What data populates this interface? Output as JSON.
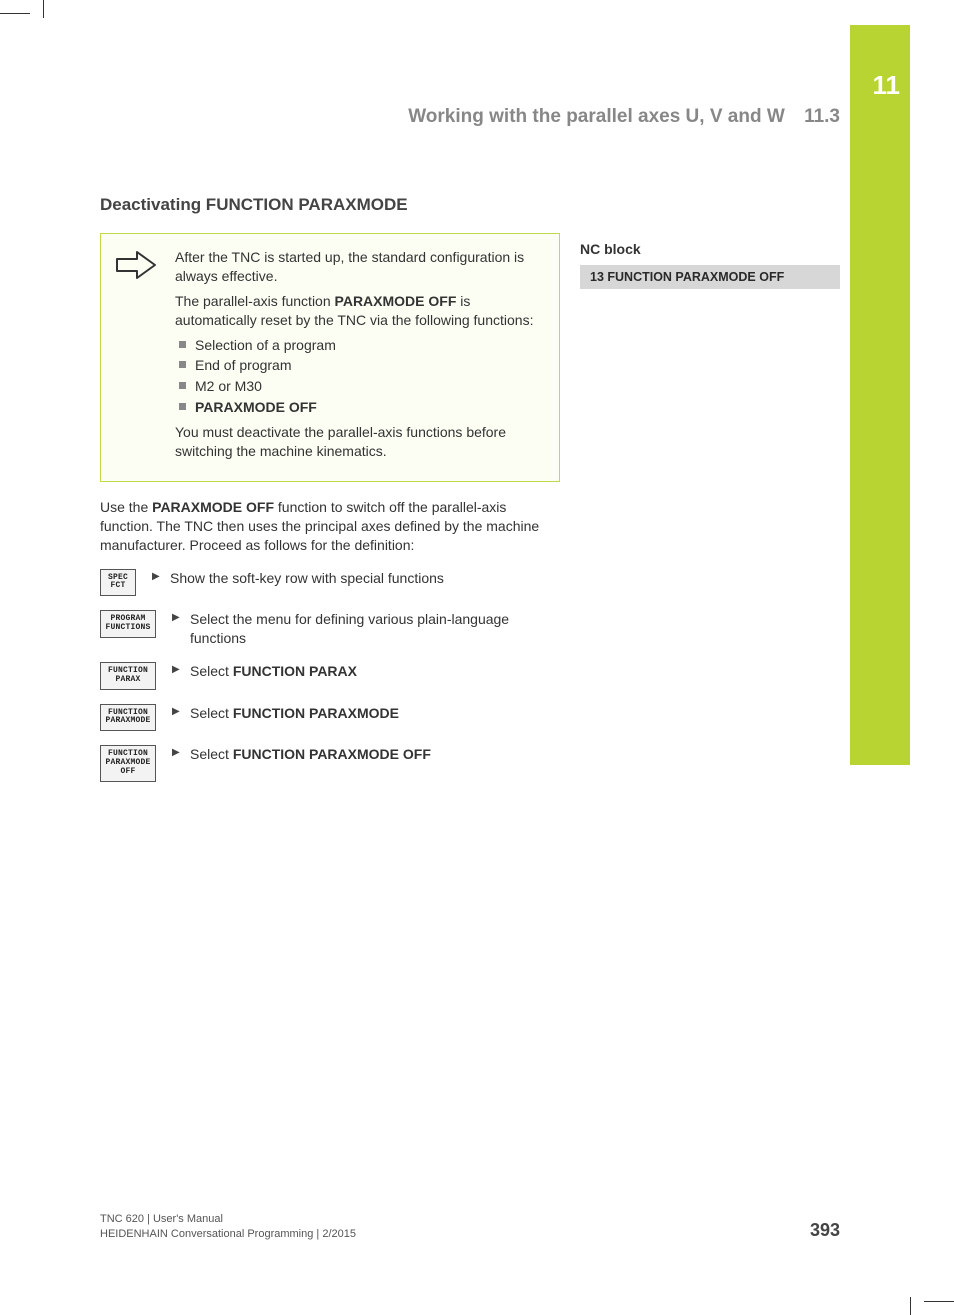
{
  "tab": {
    "chapter": "11"
  },
  "header": {
    "title": "Working with the parallel axes U, V and W",
    "section": "11.3"
  },
  "heading": "Deactivating FUNCTION PARAXMODE",
  "note": {
    "p1": "After the TNC is started up, the standard configuration is always effective.",
    "p2a": "The parallel-axis function ",
    "p2b": "PARAXMODE OFF",
    "p2c": " is automatically reset by the TNC via the following functions:",
    "items": {
      "i1": "Selection of a program",
      "i2": "End of program",
      "i3": "M2 or M30",
      "i4": "PARAXMODE OFF"
    },
    "p3": "You must deactivate the parallel-axis functions before switching the machine kinematics."
  },
  "para": {
    "a": "Use the ",
    "b": "PARAXMODE OFF",
    "c": " function to switch off the parallel-axis function. The TNC then uses the principal axes defined by the machine manufacturer. Proceed as follows for the definition:"
  },
  "softkeys": {
    "k1": "SPEC\nFCT",
    "k2": "PROGRAM\nFUNCTIONS",
    "k3": "FUNCTION\nPARAX",
    "k4": "FUNCTION\nPARAXMODE",
    "k5": "FUNCTION\nPARAXMODE\nOFF"
  },
  "steps": {
    "s1": "Show the soft-key row with special functions",
    "s2": "Select the menu for defining various plain-language functions",
    "s3a": "Select ",
    "s3b": "FUNCTION PARAX",
    "s4a": "Select ",
    "s4b": "FUNCTION PARAXMODE",
    "s5a": "Select ",
    "s5b": "FUNCTION PARAXMODE OFF"
  },
  "nc": {
    "title": "NC block",
    "block": "13 FUNCTION PARAXMODE OFF"
  },
  "footer": {
    "line1": "TNC 620 | User's Manual",
    "line2": "HEIDENHAIN Conversational Programming | 2/2015",
    "page": "393"
  }
}
